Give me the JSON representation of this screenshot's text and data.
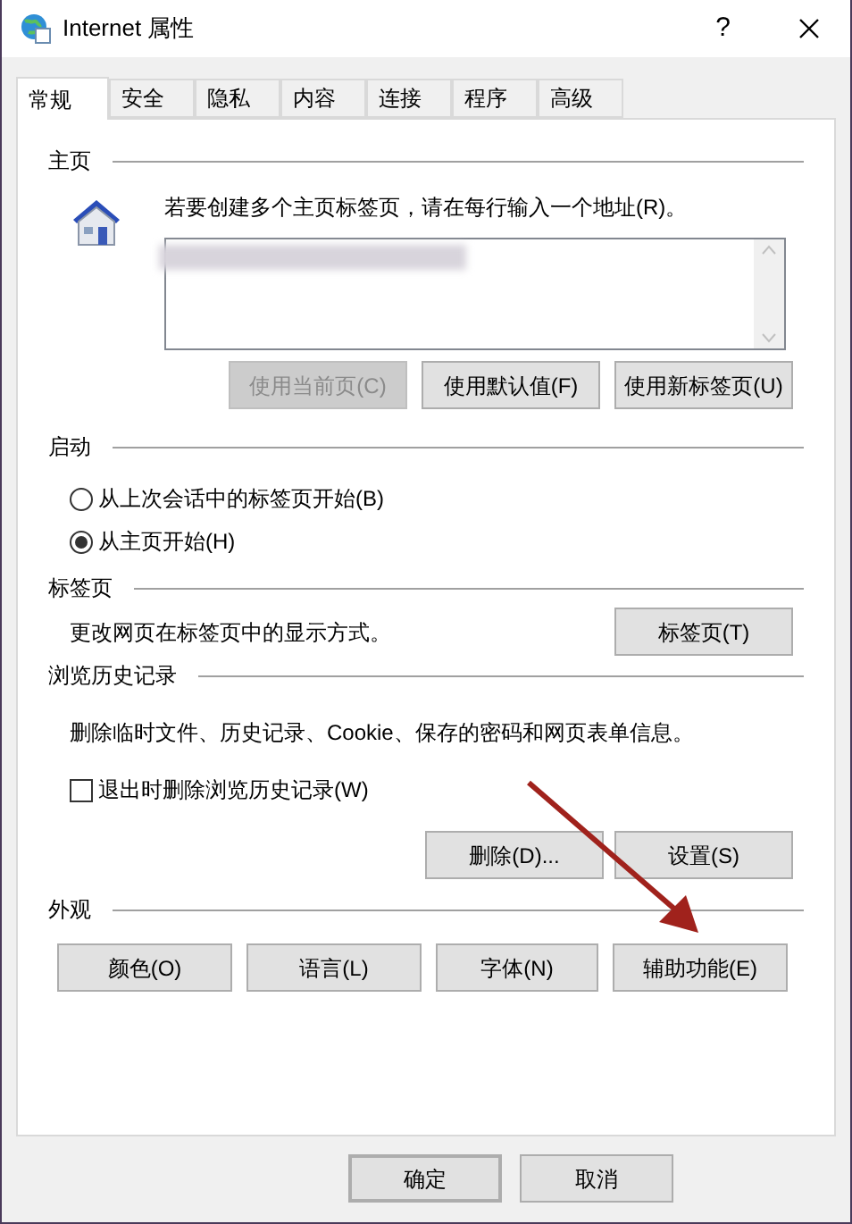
{
  "window": {
    "title": "Internet 属性",
    "help": "?"
  },
  "tabs": [
    {
      "label": "常规",
      "selected": true
    },
    {
      "label": "安全",
      "selected": false
    },
    {
      "label": "隐私",
      "selected": false
    },
    {
      "label": "内容",
      "selected": false
    },
    {
      "label": "连接",
      "selected": false
    },
    {
      "label": "程序",
      "selected": false
    },
    {
      "label": "高级",
      "selected": false
    }
  ],
  "home_page": {
    "title": "主页",
    "description": "若要创建多个主页标签页，请在每行输入一个地址(R)。",
    "address_redacted": true,
    "buttons": [
      {
        "label": "使用当前页(C)",
        "disabled": true
      },
      {
        "label": "使用默认值(F)",
        "disabled": false
      },
      {
        "label": "使用新标签页(U)",
        "disabled": false
      }
    ]
  },
  "startup": {
    "title": "启动",
    "options": [
      {
        "label": "从上次会话中的标签页开始(B)",
        "selected": false
      },
      {
        "label": "从主页开始(H)",
        "selected": true
      }
    ]
  },
  "tabs_section": {
    "title": "标签页",
    "description": "更改网页在标签页中的显示方式。",
    "button": "标签页(T)"
  },
  "history": {
    "title": "浏览历史记录",
    "description": "删除临时文件、历史记录、Cookie、保存的密码和网页表单信息。",
    "checkbox": {
      "label": "退出时删除浏览历史记录(W)",
      "checked": false
    },
    "buttons": [
      "删除(D)...",
      "设置(S)"
    ]
  },
  "appearance": {
    "title": "外观",
    "buttons": [
      "颜色(O)",
      "语言(L)",
      "字体(N)",
      "辅助功能(E)"
    ]
  },
  "footer_buttons": [
    {
      "label": "确定",
      "default": true
    },
    {
      "label": "取消",
      "default": false
    }
  ]
}
